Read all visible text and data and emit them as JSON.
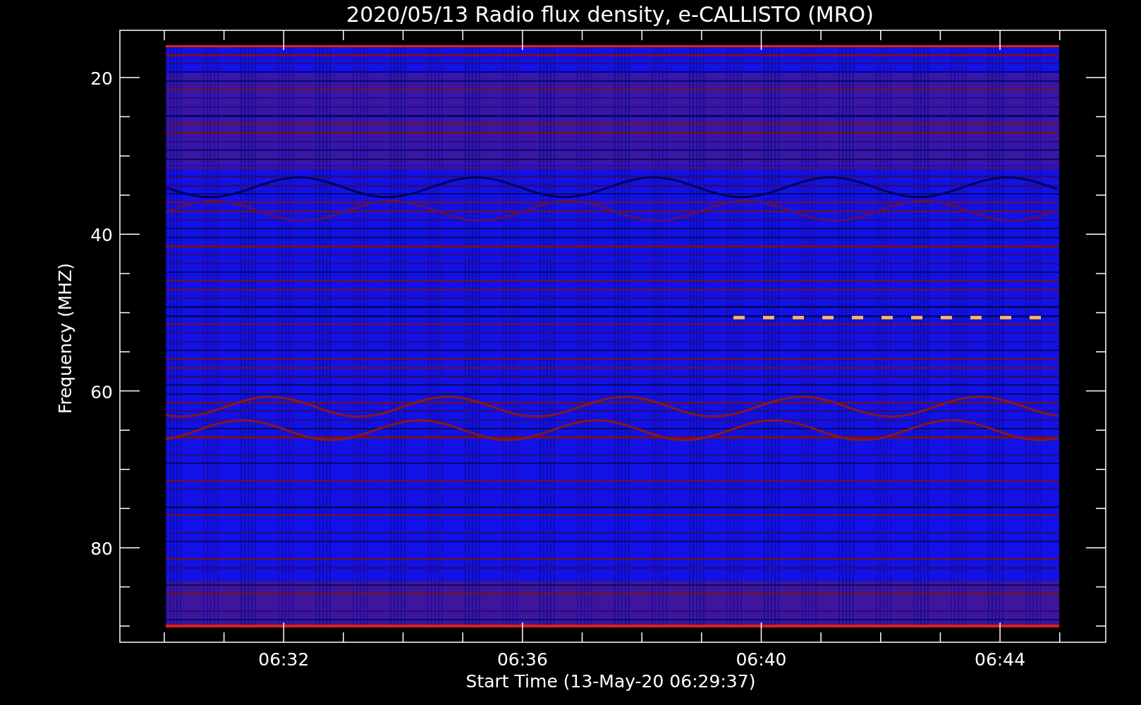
{
  "title": "2020/05/13  Radio flux density, e-CALLISTO (MRO)",
  "y_axis": {
    "label": "Frequency (MHZ)",
    "ticks": [
      "20",
      "40",
      "60",
      "80"
    ]
  },
  "x_axis": {
    "label": "Start Time (13-May-20 06:29:37)",
    "ticks": [
      "06:32",
      "06:36",
      "06:40",
      "06:44"
    ]
  }
}
